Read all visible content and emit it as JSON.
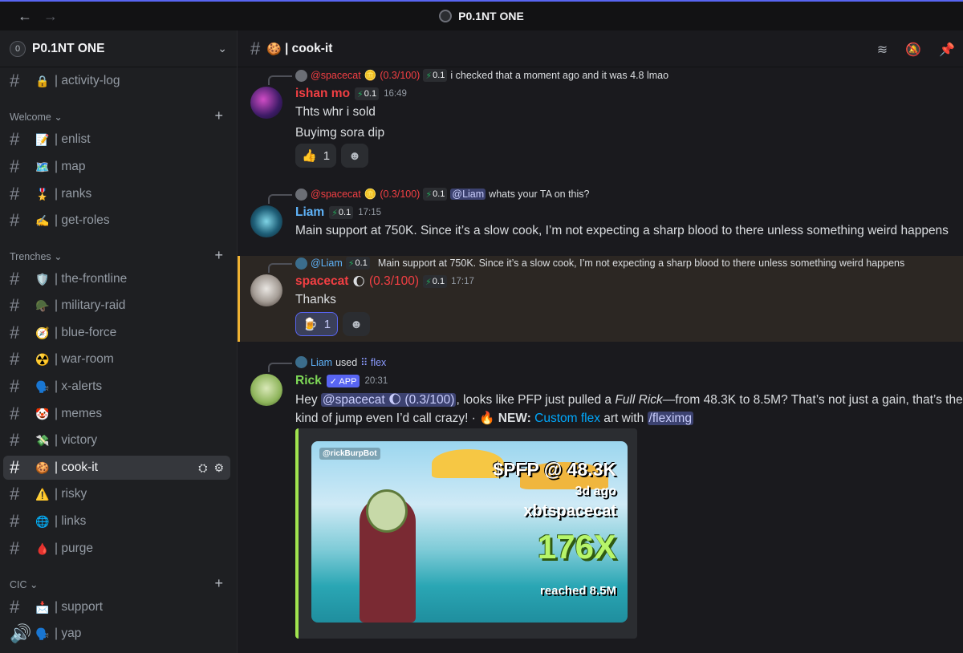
{
  "window": {
    "title": "P0.1NT ONE",
    "back": "←",
    "forward": "→"
  },
  "server": {
    "name": "P0.1NT ONE",
    "logo": "0"
  },
  "sidebar": {
    "top_channel": {
      "emoji": "🔒",
      "label": "| activity-log"
    },
    "categories": [
      {
        "name": "Welcome ⌄"
      },
      {
        "name": "Trenches ⌄"
      },
      {
        "name": "CIC ⌄"
      }
    ],
    "welcome": [
      {
        "emoji": "📝",
        "label": "| enlist"
      },
      {
        "emoji": "🗺️",
        "label": "| map"
      },
      {
        "emoji": "🎖️",
        "label": "| ranks"
      },
      {
        "emoji": "✍️",
        "label": "| get-roles"
      }
    ],
    "trenches": [
      {
        "emoji": "🛡️",
        "label": "| the-frontline"
      },
      {
        "emoji": "🪖",
        "label": "| military-raid"
      },
      {
        "emoji": "🧭",
        "label": "| blue-force"
      },
      {
        "emoji": "☢️",
        "label": "| war-room"
      },
      {
        "emoji": "🗣️",
        "label": "| x-alerts"
      },
      {
        "emoji": "🤡",
        "label": "| memes"
      },
      {
        "emoji": "💸",
        "label": "| victory"
      },
      {
        "emoji": "🍪",
        "label": "| cook-it"
      },
      {
        "emoji": "⚠️",
        "label": "| risky"
      },
      {
        "emoji": "🌐",
        "label": "| links"
      },
      {
        "emoji": "🩸",
        "label": "| purge"
      }
    ],
    "cic": [
      {
        "emoji": "📩",
        "label": "| support"
      },
      {
        "emoji": "🗣️",
        "label": "| yap"
      }
    ]
  },
  "channel": {
    "emoji": "🍪",
    "name": "| cook-it"
  },
  "messages": [
    {
      "reply": {
        "user": "@spacecat",
        "coin": "🪙",
        "score": "(0.3/100)",
        "badge": "0.1",
        "text": "i checked that a moment ago and it was 4.8 lmao"
      },
      "author": "ishan mo",
      "badge": "0.1",
      "time": "16:49",
      "lines": [
        "Thts whr i sold",
        "Buyimg sora dip"
      ],
      "reaction": {
        "emoji": "👍",
        "count": "1"
      }
    },
    {
      "reply": {
        "user": "@spacecat",
        "coin": "🪙",
        "score": "(0.3/100)",
        "badge": "0.1",
        "mention": "@Liam",
        "text": "whats your TA on this?"
      },
      "author": "Liam",
      "badge": "0.1",
      "time": "17:15",
      "lines": [
        "Main support at 750K. Since it’s a slow cook, I’m not expecting a sharp blood to there unless something weird happens"
      ]
    },
    {
      "reply": {
        "user": "@Liam",
        "badge": "0.1",
        "text": "Main support at 750K. Since it’s a slow cook, I’m not expecting a sharp blood to there unless something weird happens"
      },
      "author": "spacecat",
      "coin": "🌔",
      "score": "(0.3/100)",
      "badge": "0.1",
      "time": "17:17",
      "lines": [
        "Thanks"
      ],
      "reaction": {
        "emoji": "🍺",
        "count": "1"
      }
    },
    {
      "reply": {
        "user": "Liam",
        "used": "used",
        "command": "flex"
      },
      "author": "Rick",
      "app_badge": "✓ APP",
      "time": "20:31",
      "line1_pre": "Hey ",
      "line1_mention": "@spacecat 🌔 (0.3/100)",
      "line1_mid": ", looks like PFP just pulled a ",
      "line1_em": "Full Rick",
      "line1_post": "—from 48.3K to 8.5M? That’s not just a gain, that’s the",
      "line2_pre": "kind of jump even I’d call crazy! · 🔥 ",
      "line2_new": "NEW:",
      "line2_link": "Custom flex",
      "line2_mid": " art with ",
      "line2_cmd": "/fleximg",
      "embed": {
        "tag": "@rickBurpBot",
        "ticker": "$PFP @ 48.3K",
        "ago": "3d ago",
        "user": "xbtspacecat",
        "mult": "176X",
        "reached": "reached 8.5M"
      }
    }
  ],
  "colors": {
    "accent": "#5865f2",
    "liam": "#5fb3f9",
    "ishan": "#f23f43",
    "spacecat": "#f23f43",
    "rick": "#7ed957",
    "highlight": "#f0b232"
  }
}
